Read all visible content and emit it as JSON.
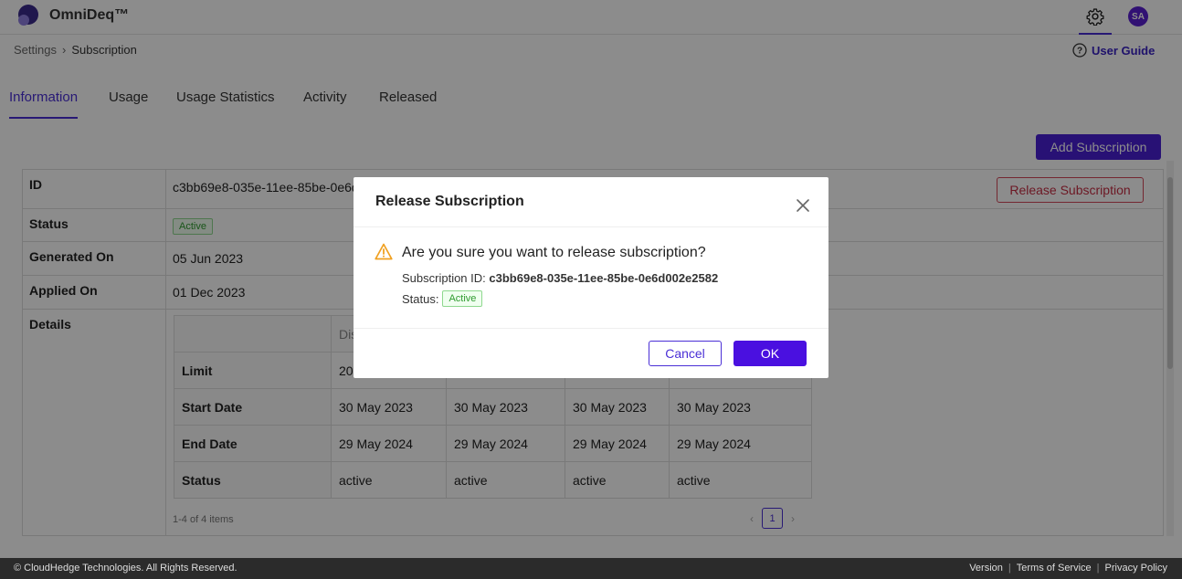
{
  "header": {
    "app_name": "OmniDeq™",
    "avatar_initials": "SA"
  },
  "breadcrumb": {
    "parent": "Settings",
    "current": "Subscription"
  },
  "user_guide_label": "User Guide",
  "tabs": [
    {
      "label": "Information",
      "active": true
    },
    {
      "label": "Usage",
      "active": false
    },
    {
      "label": "Usage Statistics",
      "active": false
    },
    {
      "label": "Activity",
      "active": false
    },
    {
      "label": "Released",
      "active": false
    }
  ],
  "add_subscription_label": "Add Subscription",
  "release_subscription_label": "Release Subscription",
  "info": {
    "id_key": "ID",
    "id_value": "c3bb69e8-035e-11ee-85be-0e6d002e2582",
    "status_key": "Status",
    "status_value": "Active",
    "generated_key": "Generated On",
    "generated_value": "05 Jun 2023",
    "applied_key": "Applied On",
    "applied_value": "01 Dec 2023",
    "details_key": "Details"
  },
  "details_table": {
    "header_partial": "Dis",
    "rows": [
      {
        "key": "Limit",
        "values": [
          "20",
          "",
          "",
          ""
        ]
      },
      {
        "key": "Start Date",
        "values": [
          "30 May 2023",
          "30 May 2023",
          "30 May 2023",
          "30 May 2023"
        ]
      },
      {
        "key": "End Date",
        "values": [
          "29 May 2024",
          "29 May 2024",
          "29 May 2024",
          "29 May 2024"
        ]
      },
      {
        "key": "Status",
        "values": [
          "active",
          "active",
          "active",
          "active"
        ]
      }
    ],
    "items_count": "1-4 of 4 items",
    "current_page": "1"
  },
  "footer": {
    "copyright": "© CloudHedge Technologies. All Rights Reserved.",
    "version": "Version",
    "terms": "Terms of Service",
    "privacy": "Privacy Policy"
  },
  "modal": {
    "title": "Release Subscription",
    "question": "Are you sure you want to release subscription?",
    "subscription_id_label": "Subscription ID:",
    "subscription_id_value": "c3bb69e8-035e-11ee-85be-0e6d002e2582",
    "status_label": "Status:",
    "status_value": "Active",
    "cancel_label": "Cancel",
    "ok_label": "OK"
  },
  "colors": {
    "accent": "#4a2fd6",
    "danger": "#c62e44",
    "success": "#2f9b2f",
    "warning": "#f0a020"
  }
}
